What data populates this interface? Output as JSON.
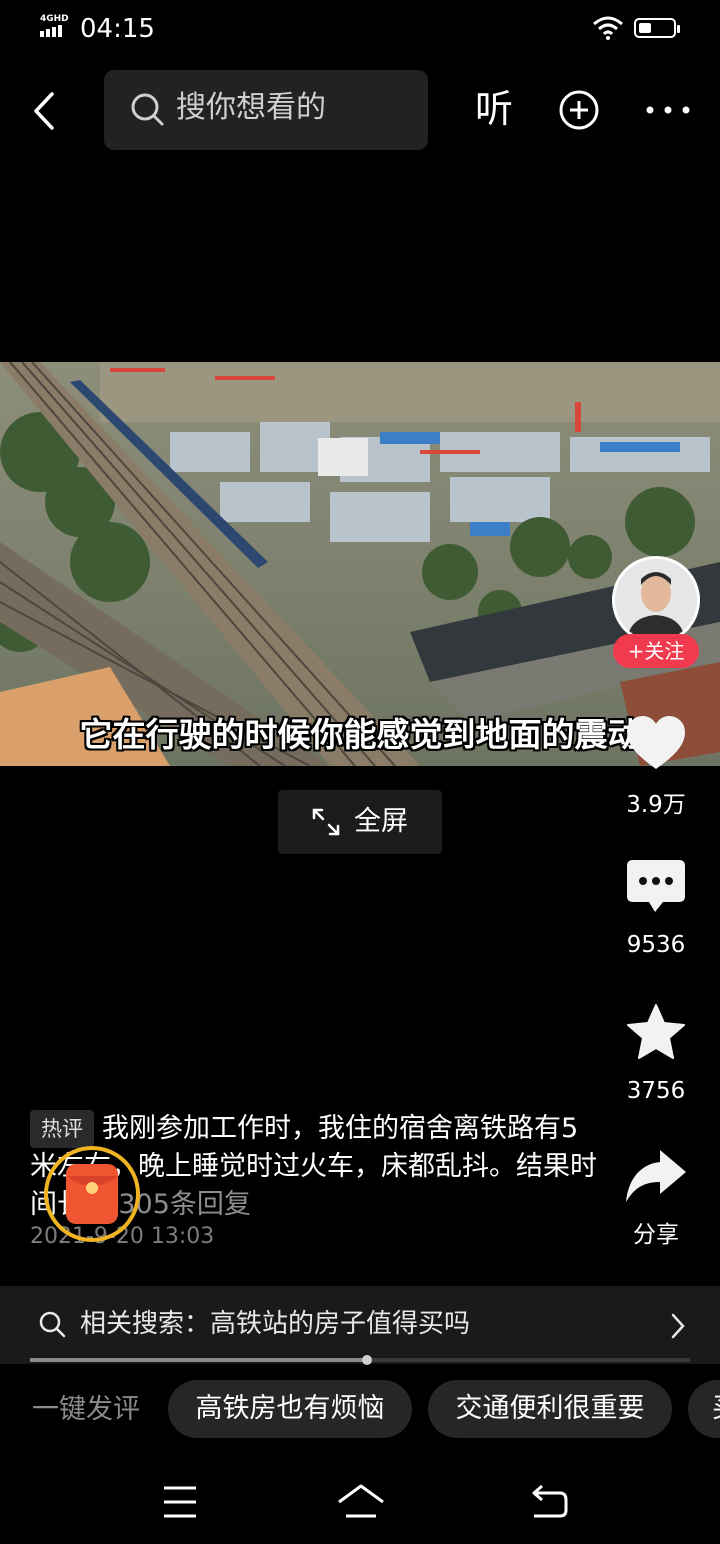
{
  "status_bar": {
    "network": "4GHD",
    "time": "04:15"
  },
  "top_bar": {
    "search_placeholder": "搜你想看的",
    "listen_label": "听"
  },
  "video": {
    "subtitle": "它在行驶的时候你能感觉到地面的震动"
  },
  "fullscreen_label": "全屏",
  "author": {
    "follow_label": "+关注"
  },
  "actions": {
    "likes": "3.9万",
    "comments": "9536",
    "favorites": "3756",
    "share_label": "分享"
  },
  "hot_comment": {
    "tag": "热评",
    "text": "我刚参加工作时，我住的宿舍离铁路有5米左右，晚上睡觉时过火车，床都乱抖。结果时间长...",
    "replies": "305条回复",
    "date": "2021-9-20 13:03"
  },
  "related_search": {
    "text": "相关搜索：高铁站的房子值得买吗"
  },
  "playback": {
    "progress": 0.51
  },
  "quick_comment": {
    "label": "一键发评",
    "chips": [
      "高铁房也有烦恼",
      "交通便利很重要",
      "买"
    ]
  },
  "colors": {
    "follow_red": "#f23a4f",
    "background": "#000000"
  }
}
